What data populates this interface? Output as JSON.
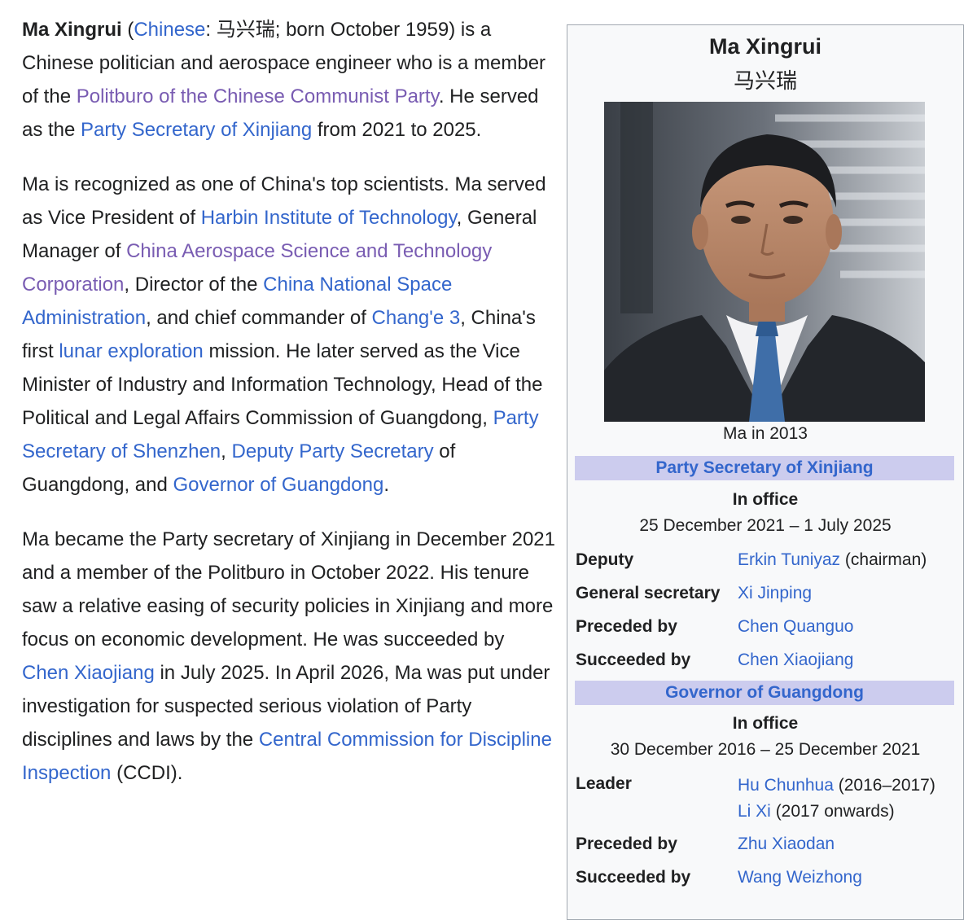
{
  "article": {
    "p1": {
      "name": "Ma Xingrui",
      "t1": " (",
      "chinese_link": "Chinese",
      "t2": ": 马兴瑞; born October 1959) is a Chinese politician and aerospace engineer who is a member of the ",
      "politburo_link": "Politburo of the Chinese Communist Party",
      "t3": ". He served as the ",
      "xinjiang_secretary_link": "Party Secretary of Xinjiang",
      "t4": " from 2021 to 2025."
    },
    "p2": {
      "t1": "Ma is recognized as one of China's top scientists. Ma served as Vice President of ",
      "hit_link": "Harbin Institute of Technology",
      "t2": ", General Manager of ",
      "casc_link": "China Aerospace Science and Technology Corporation",
      "t3": ", Director of the ",
      "cnsa_link": "China National Space Administration",
      "t4": ", and chief commander of ",
      "change3_link": "Chang'e 3",
      "t5": ", China's first ",
      "lunar_link": "lunar exploration",
      "t6": " mission. He later served as the Vice Minister of Industry and Information Technology, Head of the Political and Legal Affairs Commission of Guangdong, ",
      "shenzhen_link": "Party Secretary of Shenzhen",
      "t7": ", ",
      "deputy_link": "Deputy Party Secretary",
      "t8": " of Guangdong, and ",
      "governor_link": "Governor of Guangdong",
      "t9": "."
    },
    "p3": {
      "t1": "Ma became the Party secretary of Xinjiang in December 2021 and a member of the Politburo in October 2022. His tenure saw a relative easing of security policies in Xinjiang and more focus on economic development. He was succeeded by ",
      "chen_link": "Chen Xiaojiang",
      "t2": " in July 2025. In April 2026, Ma was put under investigation for suspected serious violation of Party disciplines and laws by the ",
      "ccdi_link": "Central Commission for Discipline Inspection",
      "t3": " (CCDI)."
    }
  },
  "infobox": {
    "name": "Ma Xingrui",
    "native_name": "马兴瑞",
    "photo_caption": "Ma in 2013",
    "office1": {
      "title": "Party Secretary of Xinjiang",
      "in_office_label": "In office",
      "term": "25 December 2021 – 1 July 2025",
      "rows": {
        "deputy": {
          "label": "Deputy",
          "link": "Erkin Tuniyaz",
          "suffix": " (chairman)"
        },
        "gensec": {
          "label": "General secretary",
          "link": "Xi Jinping"
        },
        "preceded": {
          "label": "Preceded by",
          "link": "Chen Quanguo"
        },
        "succeeded": {
          "label": "Succeeded by",
          "link": "Chen Xiaojiang"
        }
      }
    },
    "office2": {
      "title": "Governor of Guangdong",
      "in_office_label": "In office",
      "term": "30 December 2016 – 25 December 2021",
      "rows": {
        "leader": {
          "label": "Leader",
          "link1": "Hu Chunhua",
          "suffix1": " (2016–2017)",
          "link2": "Li Xi",
          "suffix2": " (2017 onwards)"
        },
        "preceded": {
          "label": "Preceded by",
          "link": "Zhu Xiaodan"
        },
        "succeeded": {
          "label": "Succeeded by",
          "link": "Wang Weizhong"
        }
      }
    }
  },
  "colors": {
    "link": "#3366cc",
    "visited_link": "#795cb2",
    "text": "#202122",
    "infobox_bg": "#f8f9fa",
    "infobox_header_bg": "#ccccee",
    "infobox_border": "#a2a9b1"
  }
}
